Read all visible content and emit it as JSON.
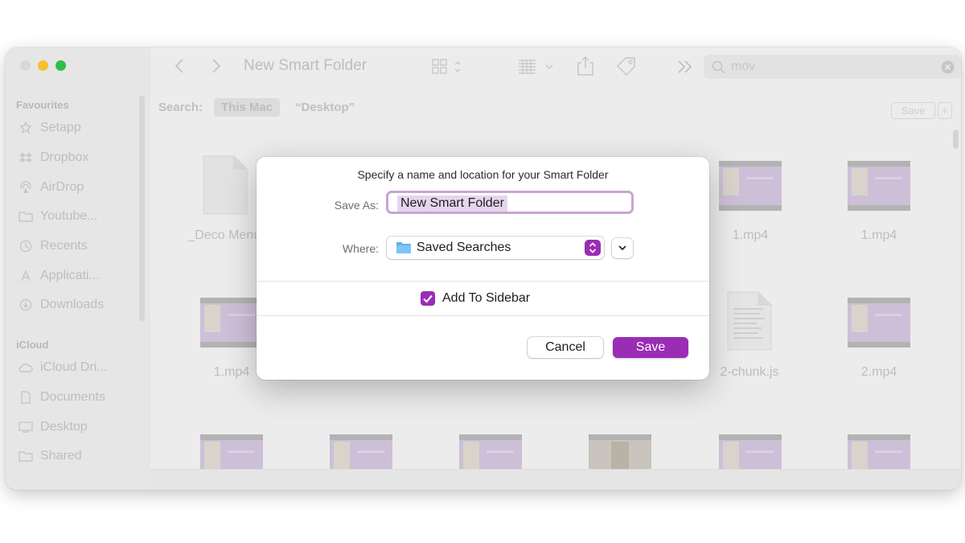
{
  "window": {
    "title": "New Smart Folder"
  },
  "sidebar": {
    "favourites_header": "Favourites",
    "favourites": [
      {
        "label": "Setapp",
        "icon": "setapp-icon"
      },
      {
        "label": "Dropbox",
        "icon": "dropbox-icon"
      },
      {
        "label": "AirDrop",
        "icon": "airdrop-icon"
      },
      {
        "label": "Youtube...",
        "icon": "folder-icon"
      },
      {
        "label": "Recents",
        "icon": "clock-icon"
      },
      {
        "label": "Applicati...",
        "icon": "applications-icon"
      },
      {
        "label": "Downloads",
        "icon": "download-icon"
      }
    ],
    "icloud_header": "iCloud",
    "icloud": [
      {
        "label": "iCloud Dri...",
        "icon": "cloud-icon"
      },
      {
        "label": "Documents",
        "icon": "document-icon"
      },
      {
        "label": "Desktop",
        "icon": "desktop-icon"
      },
      {
        "label": "Shared",
        "icon": "shared-folder-icon"
      }
    ]
  },
  "search": {
    "value": "mov"
  },
  "scope": {
    "label": "Search:",
    "this_mac": "This Mac",
    "desktop": "“Desktop”",
    "save": "Save",
    "add": "+"
  },
  "files": {
    "row1": [
      "_Deco Menu.",
      "1.mp4",
      "1.mp4"
    ],
    "row2": [
      "1.mp4",
      "2-chunk.js",
      "2.mp4"
    ]
  },
  "dialog": {
    "title": "Specify a name and location for your Smart Folder",
    "save_as_label": "Save As:",
    "save_as_value": "New Smart Folder",
    "where_label": "Where:",
    "where_value": "Saved Searches",
    "add_to_sidebar_label": "Add To Sidebar",
    "add_to_sidebar_checked": true,
    "cancel_label": "Cancel",
    "save_label": "Save"
  },
  "colors": {
    "accent": "#9a2cb5",
    "traffic_close": "#d9d9d9",
    "traffic_minimize": "#f5bf2f",
    "traffic_zoom": "#2dc043"
  }
}
